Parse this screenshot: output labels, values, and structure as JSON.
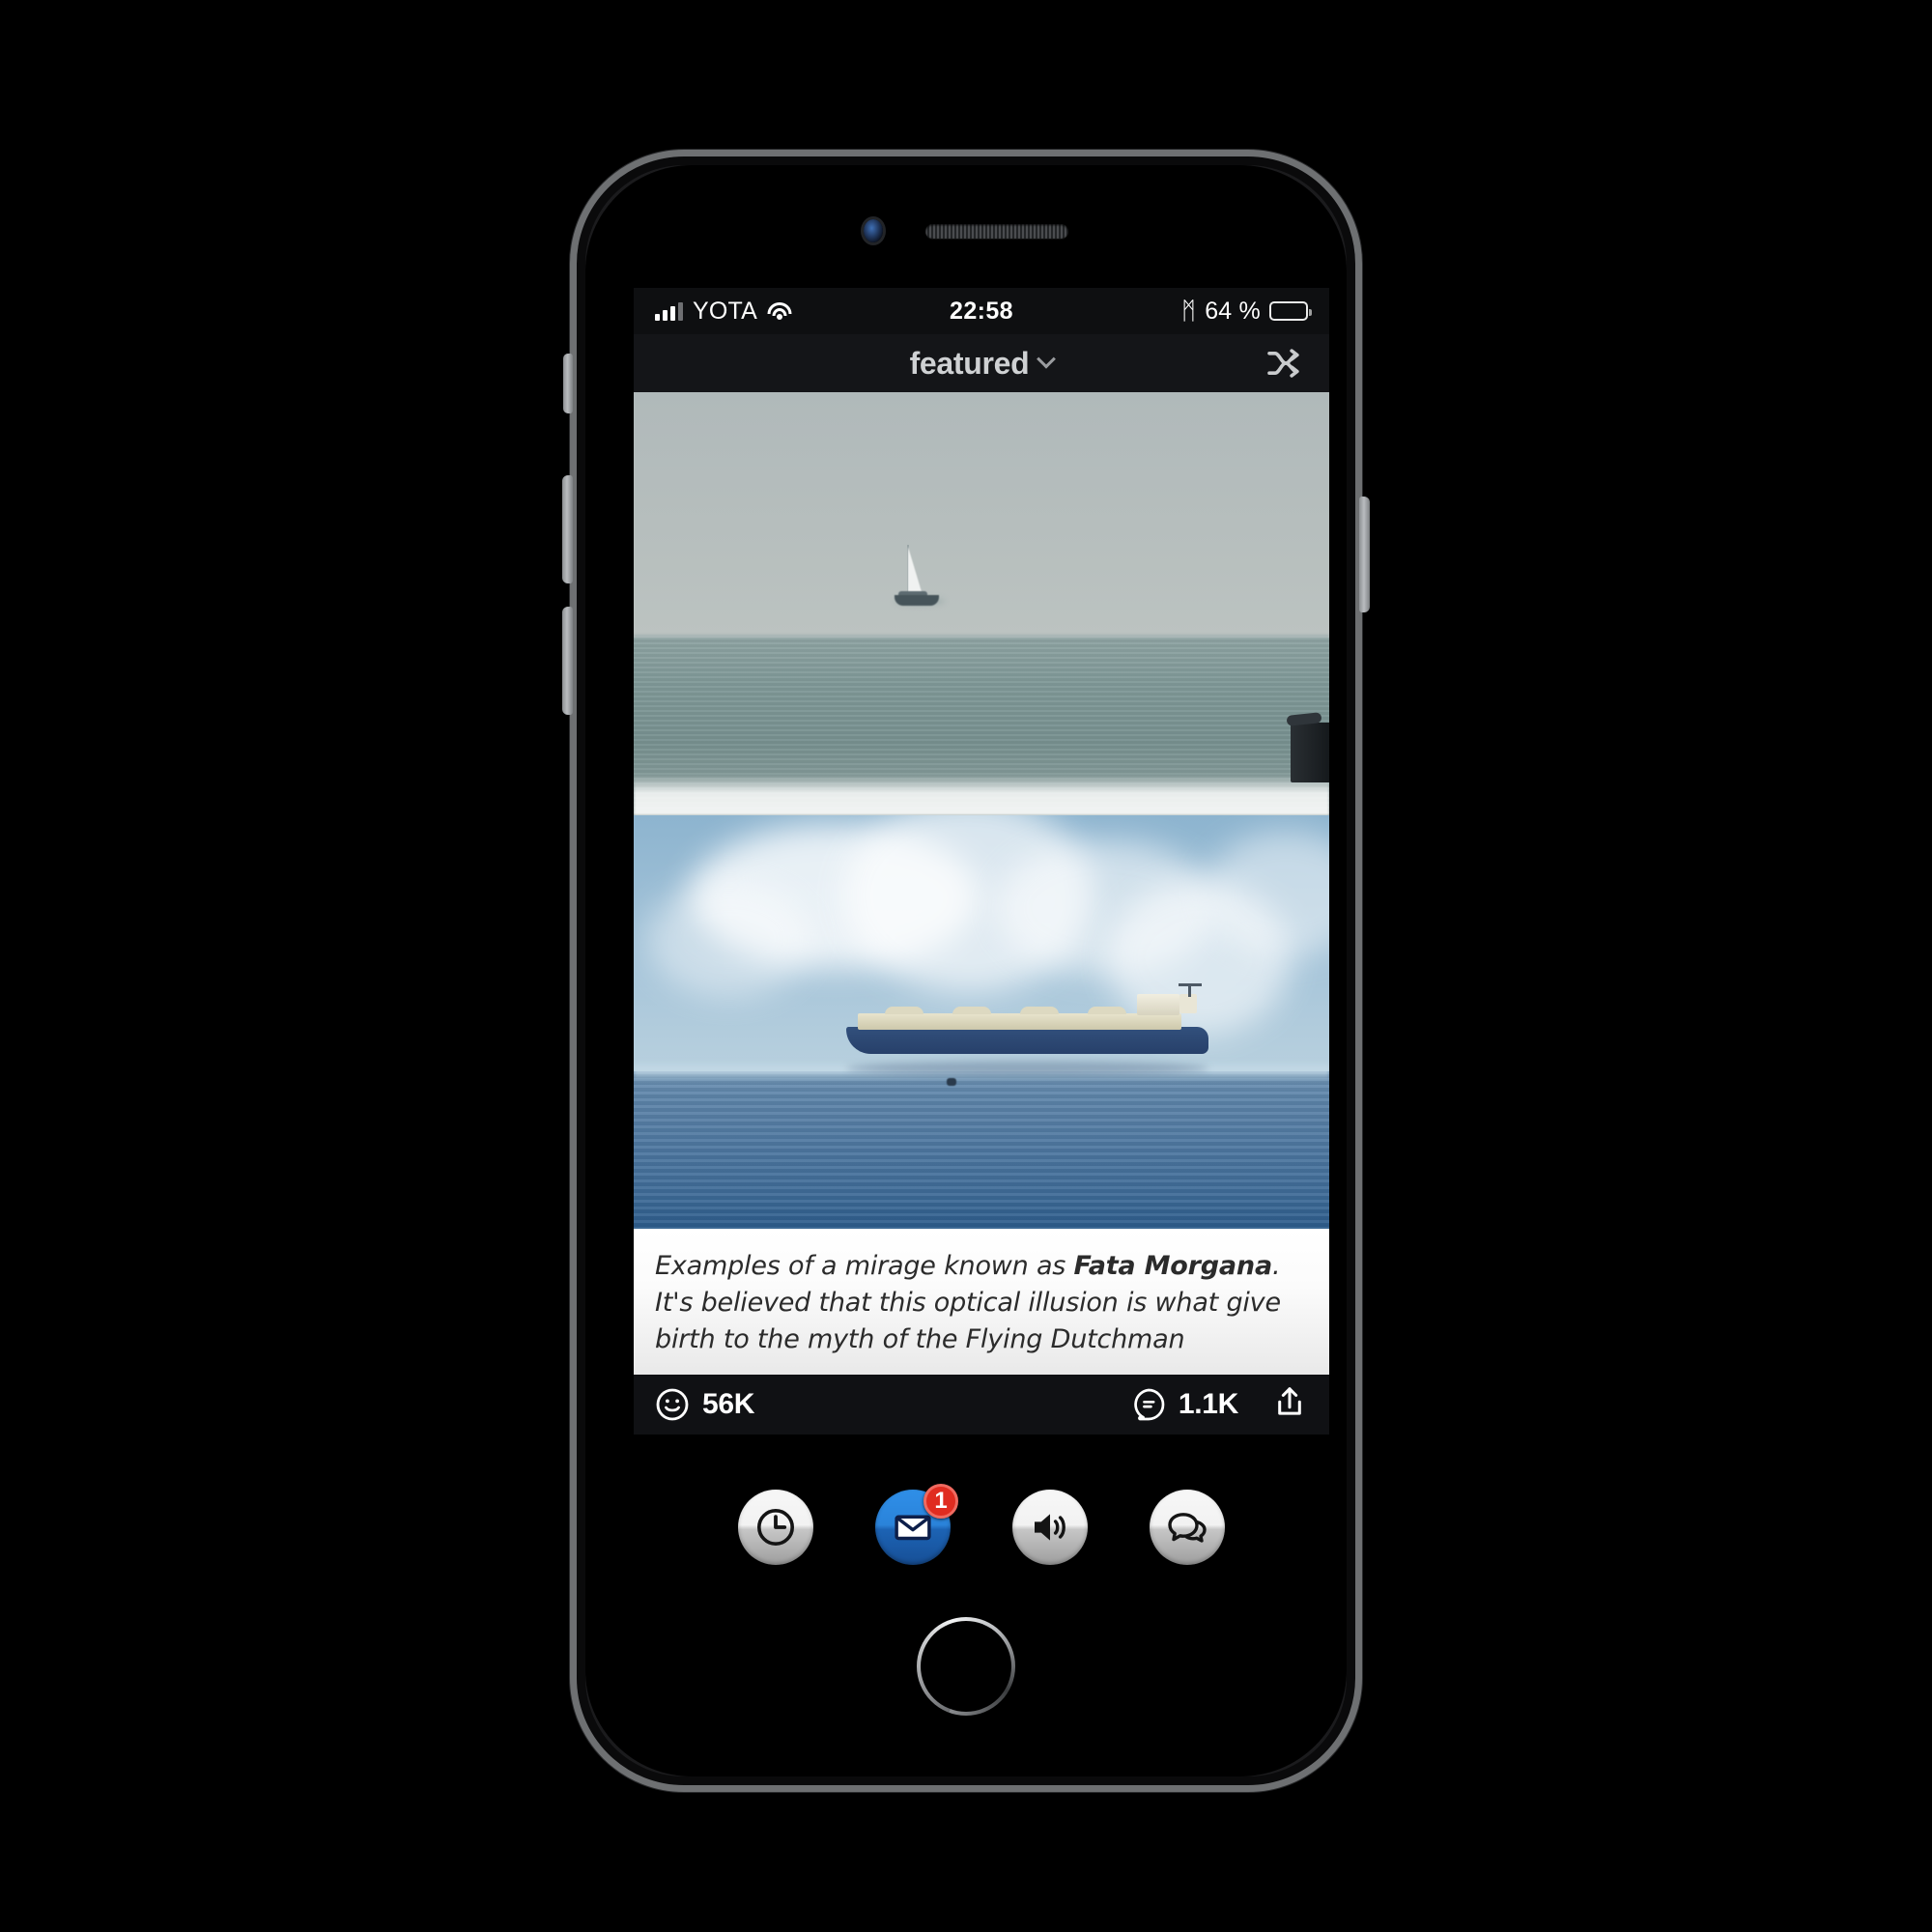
{
  "device": {
    "name": "iphone-mockup",
    "camera_icon": "front-camera-icon",
    "earpiece_icon": "earpiece-speaker-icon",
    "home_button_label": "Home"
  },
  "statusbar": {
    "carrier": "YOTA",
    "signal_icon": "cellular-signal-icon",
    "signal_bars_filled": 3,
    "signal_bars_total": 4,
    "wifi_icon": "wifi-icon",
    "time": "22:58",
    "bluetooth_icon": "bluetooth-icon",
    "bluetooth_glyph": "ᛗ",
    "battery_percent": "64 %",
    "battery_level": 64,
    "battery_icon": "battery-icon"
  },
  "header": {
    "feed_title": "featured",
    "dropdown_icon": "chevron-down-icon",
    "shuffle_icon": "shuffle-icon"
  },
  "post": {
    "photos": [
      {
        "name": "photo-sailboat-mirage",
        "alt": "Sailboat appearing to float above the horizon over a gray-green sea"
      },
      {
        "name": "photo-tanker-mirage",
        "alt": "LNG tanker ship appearing to hover above a blue sea under white clouds"
      }
    ],
    "caption_part1": "Examples of a mirage known as ",
    "caption_bold": "Fata Morgana",
    "caption_part2": ". It's believed that this optical illusion is what give birth to the myth of the Flying Dutchman",
    "reactions": {
      "icon": "smiley-reaction-icon",
      "count": "56K"
    },
    "comments": {
      "icon": "comment-icon",
      "count": "1.1K"
    },
    "share": {
      "icon": "share-icon"
    }
  },
  "dock": {
    "items": [
      {
        "name": "clock-icon",
        "label": "Clock",
        "style": "gray",
        "badge": null
      },
      {
        "name": "mail-icon",
        "label": "Mail",
        "style": "blue",
        "badge": "1"
      },
      {
        "name": "speaker-icon",
        "label": "Volume",
        "style": "gray",
        "badge": null
      },
      {
        "name": "chat-icon",
        "label": "Chat",
        "style": "gray",
        "badge": null
      }
    ]
  },
  "colors": {
    "accent_blue": "#2a83da",
    "badge_red": "#e02c20",
    "header_bg": "#141518",
    "statusbar_bg": "#0e0f11",
    "actionbar_bg": "#101114"
  }
}
